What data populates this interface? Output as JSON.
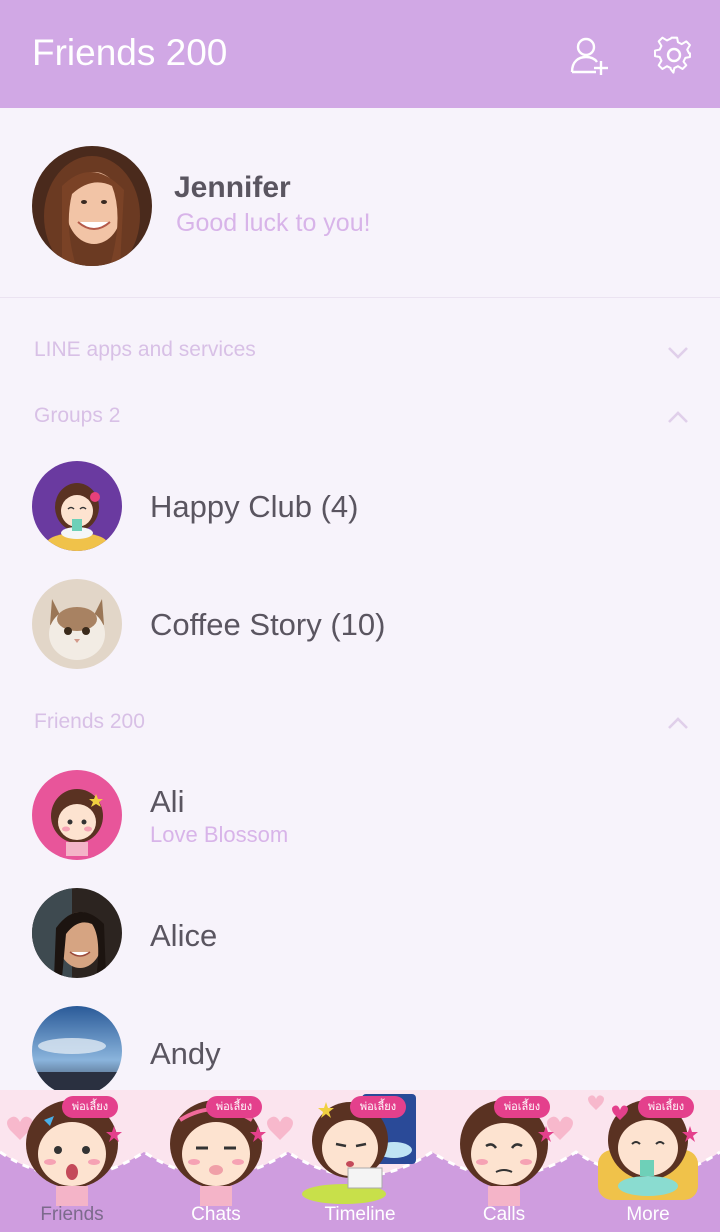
{
  "header": {
    "title": "Friends 200",
    "add_friend_icon": "add-friend-icon",
    "settings_icon": "gear-icon"
  },
  "profile": {
    "name": "Jennifer",
    "status": "Good luck to you!"
  },
  "sections": {
    "line_apps": {
      "label": "LINE apps and services",
      "state": "collapsed"
    },
    "groups": {
      "label": "Groups 2",
      "state": "expanded"
    },
    "friends": {
      "label": "Friends 200",
      "state": "expanded"
    }
  },
  "groups": [
    {
      "name": "Happy Club (4)"
    },
    {
      "name": "Coffee Story (10)"
    }
  ],
  "friends": [
    {
      "name": "Ali",
      "status": "Love Blossom"
    },
    {
      "name": "Alice"
    },
    {
      "name": "Andy"
    }
  ],
  "tabs": [
    {
      "label": "Friends",
      "active": true
    },
    {
      "label": "Chats"
    },
    {
      "label": "Timeline"
    },
    {
      "label": "Calls"
    },
    {
      "label": "More"
    }
  ],
  "sticker_badge": "พ่อเลี้ยง",
  "colors": {
    "header": "#d1a8e5",
    "background": "#f7f3fb",
    "accent_text": "#d8b4e9",
    "primary_text": "#5a5560"
  }
}
